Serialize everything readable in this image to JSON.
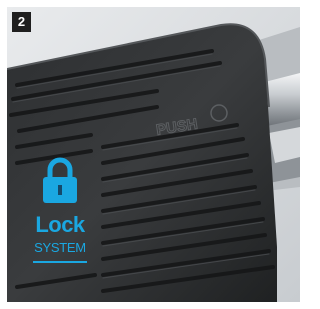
{
  "badge": {
    "step": "2"
  },
  "pedal": {
    "embossed_text": "PUSH"
  },
  "lock_logo": {
    "icon": "padlock-icon",
    "word": "Lock",
    "subword": "SYSTEM",
    "color": "#1aa7e1"
  }
}
